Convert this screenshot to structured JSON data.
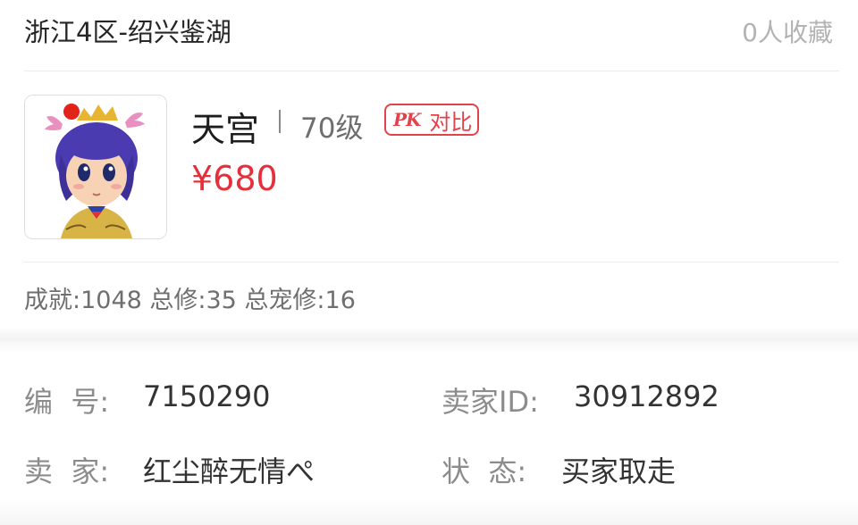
{
  "header": {
    "server": "浙江4区-绍兴鉴湖",
    "favorites": "0人收藏"
  },
  "role": {
    "avatar_icon": "character-avatar-icon",
    "name": "天宫",
    "level": "70级",
    "pk_icon_text": "PK",
    "pk_label": "对比",
    "price": "¥680"
  },
  "stats_line": "成就:1048 总修:35 总宠修:16",
  "details": {
    "serial_label": "编  号:",
    "serial_value": "7150290",
    "seller_id_label": "卖家ID:",
    "seller_id_value": "30912892",
    "seller_label": "卖  家:",
    "seller_value": "红尘醉无情ぺ",
    "status_label": "状  态:",
    "status_value": "买家取走"
  },
  "colors": {
    "accent": "#e3303b",
    "muted": "#8c8c8c"
  }
}
